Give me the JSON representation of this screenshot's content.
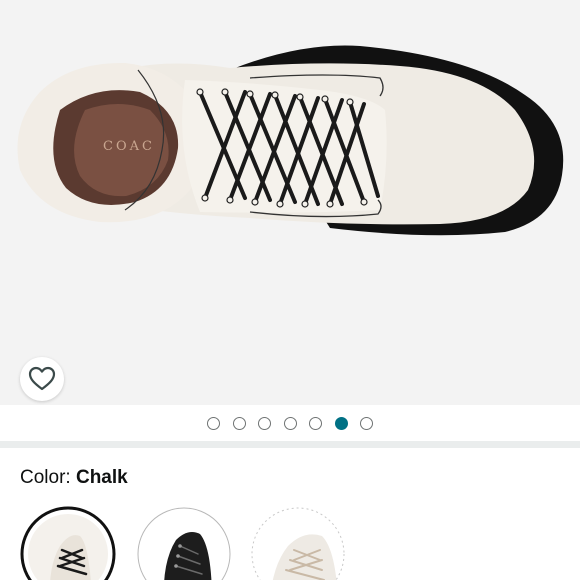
{
  "gallery": {
    "image_alt": "COACH boot, top view",
    "insole_brand_text": "COAC",
    "dots_count": 7,
    "active_dot_index": 5
  },
  "wishlist": {
    "icon": "heart-outline-icon"
  },
  "color": {
    "label": "Color:",
    "selected": "Chalk"
  },
  "swatches": [
    {
      "name": "chalk-swatch",
      "selected": true
    },
    {
      "name": "black-swatch",
      "selected": false
    },
    {
      "name": "white-swatch",
      "selected": false
    }
  ],
  "colors": {
    "accent_dot": "#007185",
    "gallery_bg": "#f3f3f3",
    "divider": "#eaeded",
    "boot_leather": "#efebe4",
    "sole": "#111111"
  }
}
